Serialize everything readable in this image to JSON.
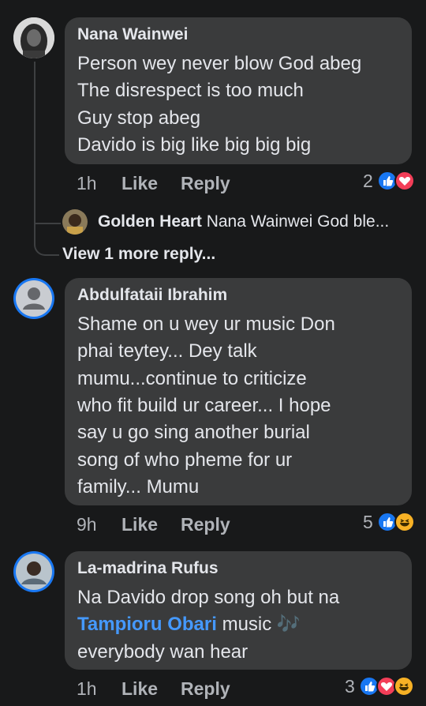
{
  "comments": [
    {
      "author": "Nana Wainwei",
      "lines": [
        "Person wey never blow God abeg",
        "The disrespect is too much",
        "Guy stop abeg",
        "Davido is big like big big big"
      ],
      "time": "1h",
      "like": "Like",
      "reply": "Reply",
      "reaction_count": "2",
      "reactions": [
        "like-icon",
        "love-icon"
      ],
      "replies": {
        "reply_author": "Golden Heart",
        "reply_preview": "Nana Wainwei God ble...",
        "view_more": "View 1 more reply..."
      }
    },
    {
      "author": "Abdulfataii Ibrahim",
      "lines": [
        "Shame  on u wey ur music Don",
        "phai teytey... Dey  talk",
        "mumu...continue to  criticize",
        "who fit build  ur career... I hope",
        "say u go sing  another burial",
        "song of who pheme  for ur",
        "family... Mumu"
      ],
      "time": "9h",
      "like": "Like",
      "reply": "Reply",
      "reaction_count": "5",
      "reactions": [
        "like-icon",
        "haha-icon"
      ]
    },
    {
      "author": "La-madrina Rufus",
      "line1": "Na Davido drop song oh but na",
      "mention": "Tampioru Obari",
      "line2_rest": " music 🎶",
      "line3": "everybody wan hear",
      "time": "1h",
      "like": "Like",
      "reply": "Reply",
      "reaction_count": "3",
      "reactions": [
        "like-icon",
        "love-icon",
        "haha-icon"
      ]
    }
  ],
  "colors": {
    "background": "#18191a",
    "bubble": "#3a3b3c",
    "text": "#e4e6eb",
    "secondary": "#b0b3b8",
    "link": "#4599ff",
    "like_blue": "#1877f2",
    "love_red": "#f33e58",
    "haha_yellow": "#f7b125"
  }
}
